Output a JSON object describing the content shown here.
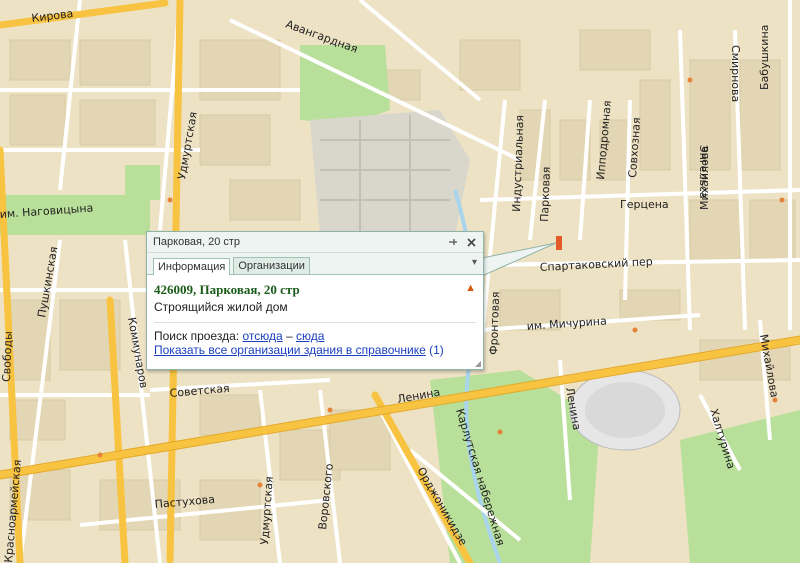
{
  "map": {
    "street_labels": [
      {
        "id": "kirova",
        "text": "Кирова"
      },
      {
        "id": "avangardnaya",
        "text": "Авангардная"
      },
      {
        "id": "udmurtskaya-n",
        "text": "Удмуртская"
      },
      {
        "id": "nagovitsyna",
        "text": "им. Наговицына"
      },
      {
        "id": "pushkinskaya",
        "text": "Пушкинская"
      },
      {
        "id": "kommunarov",
        "text": "Коммунаров"
      },
      {
        "id": "svobody",
        "text": "Свободы"
      },
      {
        "id": "sovetskaya",
        "text": "Советская"
      },
      {
        "id": "krasnoarmeyskaya",
        "text": "Красноармейская"
      },
      {
        "id": "pastukhova",
        "text": "Пастухова"
      },
      {
        "id": "udmurtskaya-s",
        "text": "Удмуртская"
      },
      {
        "id": "vorovskogo",
        "text": "Воровского"
      },
      {
        "id": "ordzhonikidze",
        "text": "Орджоникидзе"
      },
      {
        "id": "karlutskaya",
        "text": "Карлутская набережная"
      },
      {
        "id": "lenina",
        "text": "Ленина"
      },
      {
        "id": "lenina-v",
        "text": "Ленина"
      },
      {
        "id": "frontovaya",
        "text": "Фронтовая"
      },
      {
        "id": "industrialnaya",
        "text": "Индустриальная"
      },
      {
        "id": "parkovaya",
        "text": "Парковая"
      },
      {
        "id": "ippodromnaya",
        "text": "Ипподромная"
      },
      {
        "id": "sovkhoznaya",
        "text": "Совхозная"
      },
      {
        "id": "gertsena",
        "text": "Герцена"
      },
      {
        "id": "spartakovsky",
        "text": "Спартаковский пер"
      },
      {
        "id": "michurina",
        "text": "им. Мичурина"
      },
      {
        "id": "mikhaylova",
        "text": "Михайлова"
      },
      {
        "id": "engelsa",
        "text": "Энгельса"
      },
      {
        "id": "smirnova",
        "text": "Смирнова"
      },
      {
        "id": "babushkina",
        "text": "Бабушкина"
      },
      {
        "id": "khaltyrina",
        "text": "Халтурина"
      },
      {
        "id": "mikhaylova-s",
        "text": "Михайлова"
      }
    ]
  },
  "popup": {
    "title": "Парковая, 20 стр",
    "tabs": [
      {
        "label": "Информация",
        "active": true
      },
      {
        "label": "Организации",
        "active": false
      }
    ],
    "address": "426009, Парковая, 20 стр",
    "description": "Строящийся жилой дом",
    "route_label": "Поиск проезда:",
    "route_from": "отсюда",
    "route_dash": "–",
    "route_to": "сюда",
    "orgs_link": "Показать все организации здания в справочнике",
    "orgs_count": "(1)",
    "icons": {
      "pin": "pin-icon",
      "close": "close-icon",
      "warning": "warning-icon",
      "more": "more-icon"
    }
  },
  "colors": {
    "land": "#eee2c4",
    "block": "#e3d6b4",
    "park": "#b9e09a",
    "major_road": "#f7c341",
    "road": "#ffffff",
    "popup_border": "#8fb3a8",
    "link": "#1a3fbf",
    "address": "#1a5c1a"
  }
}
